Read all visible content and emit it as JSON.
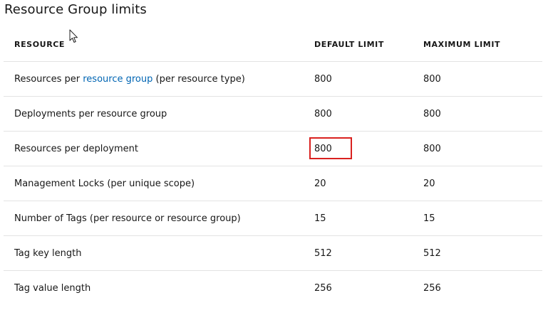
{
  "page": {
    "title": "Resource Group limits"
  },
  "table": {
    "headers": {
      "resource": "RESOURCE",
      "default_limit": "DEFAULT LIMIT",
      "maximum_limit": "MAXIMUM LIMIT"
    },
    "rows": [
      {
        "resource_prefix": "Resources per ",
        "resource_link": "resource group",
        "resource_suffix": " (per resource type)",
        "default_limit": "800",
        "maximum_limit": "800"
      },
      {
        "resource": "Deployments per resource group",
        "default_limit": "800",
        "maximum_limit": "800"
      },
      {
        "resource": "Resources per deployment",
        "default_limit": "800",
        "maximum_limit": "800",
        "highlighted": true
      },
      {
        "resource": "Management Locks (per unique scope)",
        "default_limit": "20",
        "maximum_limit": "20"
      },
      {
        "resource": "Number of Tags (per resource or resource group)",
        "default_limit": "15",
        "maximum_limit": "15"
      },
      {
        "resource": "Tag key length",
        "default_limit": "512",
        "maximum_limit": "512"
      },
      {
        "resource": "Tag value length",
        "default_limit": "256",
        "maximum_limit": "256"
      }
    ]
  },
  "annotations": {
    "highlight_color": "#d9211f"
  },
  "colors": {
    "link": "#0065b3",
    "text": "#171717",
    "row_divider": "#e3e3e3"
  },
  "icons": {
    "cursor": "mouse-pointer-icon"
  }
}
